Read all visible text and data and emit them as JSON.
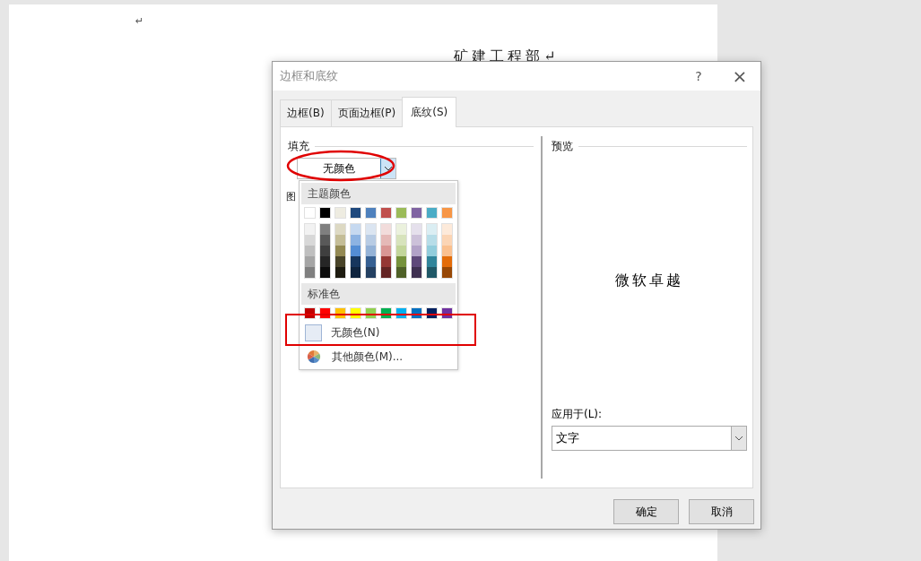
{
  "document": {
    "marks": [
      "↵"
    ],
    "heading": "矿建工程部↵"
  },
  "dialog": {
    "title": "边框和底纹",
    "help": "?",
    "close": "×",
    "tabs": [
      {
        "label": "边框(B)",
        "selected": false
      },
      {
        "label": "页面边框(P)",
        "selected": false
      },
      {
        "label": "底纹(S)",
        "selected": true
      }
    ],
    "fill": {
      "label": "填充",
      "value": "无颜色"
    },
    "pattern": {
      "label": "图"
    },
    "palette": {
      "theme_heading": "主题颜色",
      "theme_row": [
        {
          "color": "#ffffff"
        },
        {
          "color": "#000000"
        },
        {
          "color": "#eeece1"
        },
        {
          "color": "#1f497d"
        },
        {
          "color": "#4f81bd"
        },
        {
          "color": "#c0504d"
        },
        {
          "color": "#9bbb59"
        },
        {
          "color": "#8064a2"
        },
        {
          "color": "#4bacc6"
        },
        {
          "color": "#f79646"
        }
      ],
      "shades": [
        [
          {
            "color": "#f2f2f2"
          },
          {
            "color": "#d8d8d8"
          },
          {
            "color": "#bfbfbf"
          },
          {
            "color": "#a5a5a5"
          },
          {
            "color": "#7f7f7f"
          }
        ],
        [
          {
            "color": "#7f7f7f"
          },
          {
            "color": "#595959"
          },
          {
            "color": "#3f3f3f"
          },
          {
            "color": "#262626"
          },
          {
            "color": "#0c0c0c"
          }
        ],
        [
          {
            "color": "#ddd9c3"
          },
          {
            "color": "#c4bd97"
          },
          {
            "color": "#938953"
          },
          {
            "color": "#494429"
          },
          {
            "color": "#1d1b10"
          }
        ],
        [
          {
            "color": "#c6d9f0"
          },
          {
            "color": "#8db3e2"
          },
          {
            "color": "#548dd4"
          },
          {
            "color": "#17365d"
          },
          {
            "color": "#0f243e"
          }
        ],
        [
          {
            "color": "#dbe5f1"
          },
          {
            "color": "#b8cce4"
          },
          {
            "color": "#95b3d7"
          },
          {
            "color": "#366092"
          },
          {
            "color": "#244061"
          }
        ],
        [
          {
            "color": "#f2dcdb"
          },
          {
            "color": "#e5b9b7"
          },
          {
            "color": "#d99694"
          },
          {
            "color": "#953734"
          },
          {
            "color": "#632423"
          }
        ],
        [
          {
            "color": "#ebf1dd"
          },
          {
            "color": "#d7e3bc"
          },
          {
            "color": "#c3d69b"
          },
          {
            "color": "#76923c"
          },
          {
            "color": "#4f6128"
          }
        ],
        [
          {
            "color": "#e5e0ec"
          },
          {
            "color": "#ccc1d9"
          },
          {
            "color": "#b2a2c7"
          },
          {
            "color": "#5f497a"
          },
          {
            "color": "#3f3151"
          }
        ],
        [
          {
            "color": "#dbeef3"
          },
          {
            "color": "#b7dde8"
          },
          {
            "color": "#92cddc"
          },
          {
            "color": "#31859b"
          },
          {
            "color": "#205867"
          }
        ],
        [
          {
            "color": "#fdeada"
          },
          {
            "color": "#fbd5b5"
          },
          {
            "color": "#fac08f"
          },
          {
            "color": "#e36c09"
          },
          {
            "color": "#974806"
          }
        ]
      ],
      "standard_heading": "标准色",
      "standard_row": [
        {
          "color": "#c00000"
        },
        {
          "color": "#ff0000"
        },
        {
          "color": "#ffc000"
        },
        {
          "color": "#ffff00"
        },
        {
          "color": "#92d050"
        },
        {
          "color": "#00b050"
        },
        {
          "color": "#00b0f0"
        },
        {
          "color": "#0070c0"
        },
        {
          "color": "#002060"
        },
        {
          "color": "#7030a0"
        }
      ],
      "no_color": "无颜色(N)",
      "more_colors": "其他颜色(M)..."
    },
    "preview": {
      "label": "预览",
      "sample": "微软卓越"
    },
    "apply_to": {
      "label": "应用于(L):",
      "value": "文字"
    },
    "buttons": [
      "确定",
      "取消"
    ]
  }
}
